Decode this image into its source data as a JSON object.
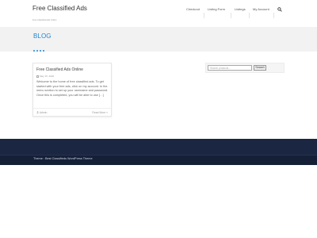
{
  "header": {
    "site_title": "Free Classified Ads",
    "tagline": "Free Classified Ads Online",
    "nav": [
      "Checkout",
      "Listing Form",
      "Listings",
      "My Account"
    ],
    "search_icon": "search-icon"
  },
  "banner": {
    "title": "BLOG"
  },
  "post": {
    "title": "Free Classified Ads Online",
    "date": "May 15, 2020",
    "excerpt": "Welcome to the home of free classified ads. To get started with your free ads, click on my account. In the menu section to set up your username and password. Once this is completed, you will be able to use […]",
    "author": "Admin",
    "read_more": "Read More »"
  },
  "sidebar": {
    "search_placeholder": "Search products…",
    "search_button": "Search"
  },
  "footer": {
    "credit": "Theme : Best Classifieds WordPress Theme"
  },
  "colors": {
    "accent": "#1f86d4",
    "footer_top": "#1b2742",
    "footer_bottom": "#151f36",
    "banner_bg": "#f2f2f2"
  }
}
